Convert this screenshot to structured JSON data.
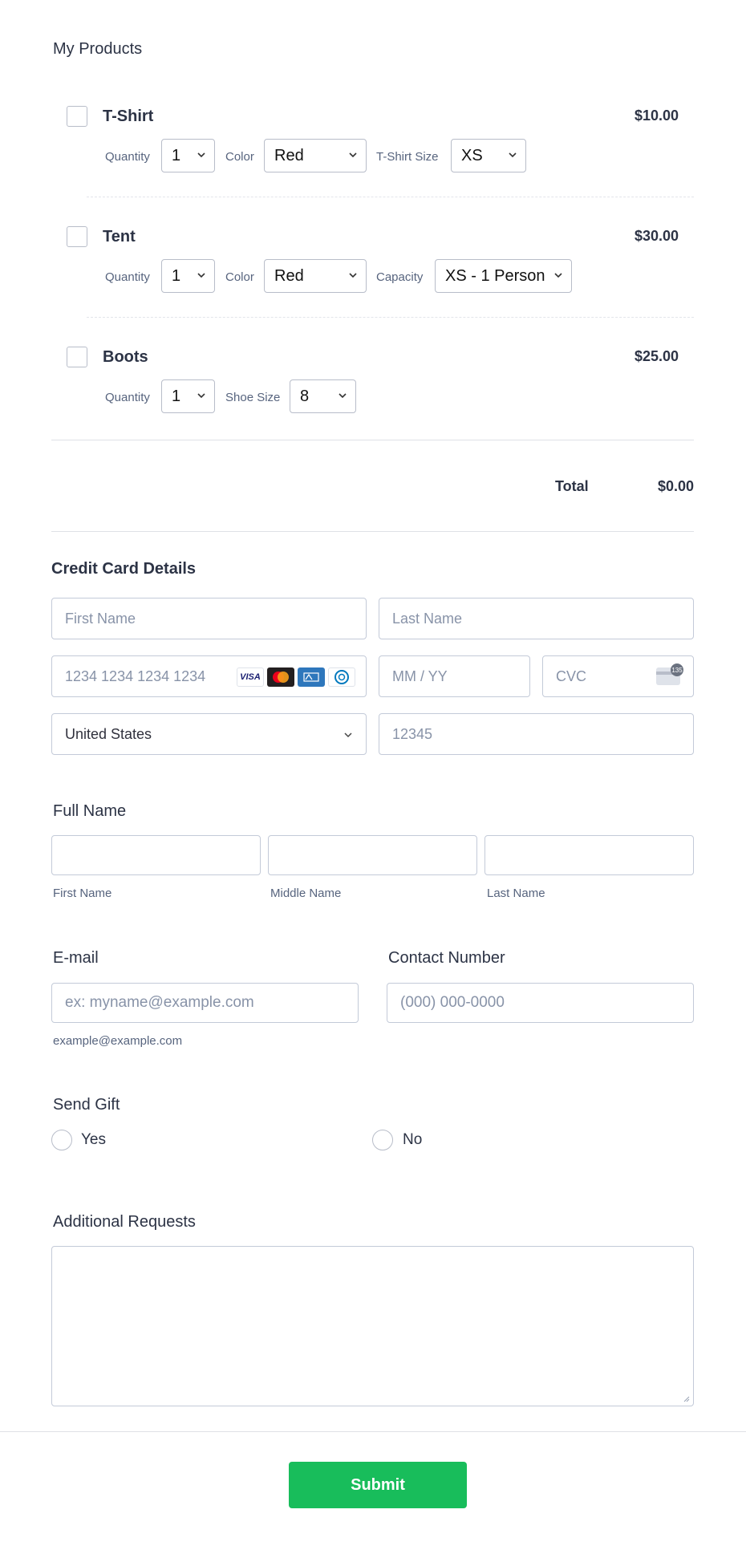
{
  "products_section": {
    "title": "My Products",
    "items": [
      {
        "name": "T-Shirt",
        "price": "$10.00",
        "options": [
          {
            "label": "Quantity",
            "value": "1"
          },
          {
            "label": "Color",
            "value": "Red"
          },
          {
            "label": "T-Shirt Size",
            "value": "XS"
          }
        ]
      },
      {
        "name": "Tent",
        "price": "$30.00",
        "options": [
          {
            "label": "Quantity",
            "value": "1"
          },
          {
            "label": "Color",
            "value": "Red"
          },
          {
            "label": "Capacity",
            "value": "XS - 1 Person"
          }
        ]
      },
      {
        "name": "Boots",
        "price": "$25.00",
        "options": [
          {
            "label": "Quantity",
            "value": "1"
          },
          {
            "label": "Shoe Size",
            "value": "8"
          }
        ]
      }
    ],
    "total_label": "Total",
    "total_value": "$0.00"
  },
  "credit_card": {
    "title": "Credit Card Details",
    "first_name_placeholder": "First Name",
    "last_name_placeholder": "Last Name",
    "card_number_placeholder": "1234 1234 1234 1234",
    "expiry_placeholder": "MM / YY",
    "cvc_placeholder": "CVC",
    "country_value": "United States",
    "zip_placeholder": "12345",
    "card_brands": [
      "VISA",
      "mastercard-icon",
      "amex-icon",
      "diners-icon"
    ],
    "cvc_badge": "135"
  },
  "full_name": {
    "label": "Full Name",
    "first_sub": "First Name",
    "middle_sub": "Middle Name",
    "last_sub": "Last Name"
  },
  "email": {
    "label": "E-mail",
    "placeholder": "ex: myname@example.com",
    "sublabel": "example@example.com"
  },
  "contact": {
    "label": "Contact Number",
    "placeholder": "(000) 000-0000"
  },
  "send_gift": {
    "label": "Send Gift",
    "options": [
      "Yes",
      "No"
    ]
  },
  "additional_requests": {
    "label": "Additional Requests"
  },
  "submit": {
    "label": "Submit",
    "color": "#18bd5b"
  },
  "colors": {
    "text": "#2c3345",
    "muted": "#57647e",
    "border": "#c3cad8"
  }
}
